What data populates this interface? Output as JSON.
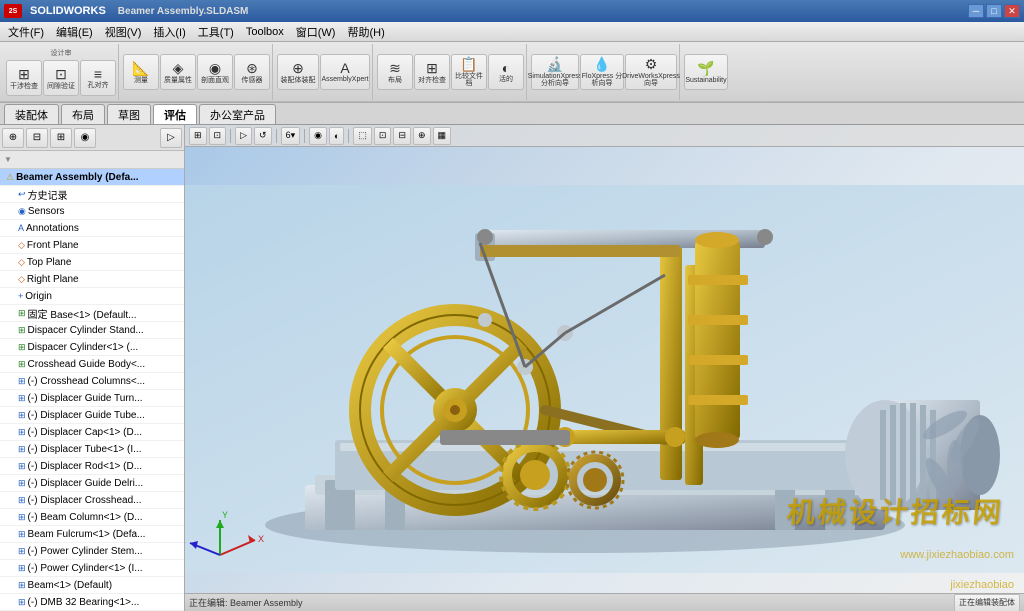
{
  "titlebar": {
    "logo": "SW",
    "title": "Beamer Assembly.SLDASM",
    "minimize": "─",
    "restore": "□",
    "close": "✕"
  },
  "menubar": {
    "items": [
      "文件(F)",
      "编辑(E)",
      "视图(V)",
      "插入(I)",
      "工具(T)",
      "Toolbox",
      "窗口(W)",
      "帮助(H)"
    ]
  },
  "toolbar": {
    "groups": [
      {
        "name": "设计审",
        "buttons": [
          {
            "icon": "⊞",
            "label": "干涉检查"
          },
          {
            "icon": "⊡",
            "label": "间隙验证"
          },
          {
            "icon": "≡",
            "label": "孔对齐"
          },
          {
            "icon": "📏",
            "label": "测量"
          },
          {
            "icon": "◈",
            "label": "质量属性"
          },
          {
            "icon": "◉",
            "label": "剖面直观"
          },
          {
            "icon": "⊛",
            "label": "传感器"
          },
          {
            "icon": "⊕",
            "label": "装配体装配"
          },
          {
            "icon": "A",
            "label": "AssemblyXpert"
          },
          {
            "icon": "≋",
            "label": "布局"
          },
          {
            "icon": "⊞",
            "label": "对齐检查"
          },
          {
            "icon": "📋",
            "label": "比较文件"
          },
          {
            "icon": "◐",
            "label": "活的"
          },
          {
            "icon": "🔬",
            "label": "SimulationXpress 分析向导"
          },
          {
            "icon": "🔭",
            "label": "FloXpress 分析向导"
          },
          {
            "icon": "⚙",
            "label": "DriveWorksXpress 向导"
          },
          {
            "icon": "🌱",
            "label": "Sustainability"
          }
        ]
      }
    ]
  },
  "tabs": [
    "装配体",
    "布局",
    "草图",
    "评估",
    "办公室产品"
  ],
  "active_tab": "评估",
  "left_panel": {
    "toolbar_buttons": [
      "⊕",
      "⊟",
      "⊞",
      "◉"
    ],
    "tree_header": "Beamer Assembly (Defa...",
    "filter_icon": "▼",
    "tree_items": [
      {
        "indent": 0,
        "icon": "⚠",
        "icon_class": "yellow",
        "text": "Beamer Assembly  (Defa..."
      },
      {
        "indent": 1,
        "icon": "↩",
        "icon_class": "blue",
        "text": "方史记录"
      },
      {
        "indent": 1,
        "icon": "◉",
        "icon_class": "blue",
        "text": "Sensors"
      },
      {
        "indent": 1,
        "icon": "A",
        "icon_class": "blue",
        "text": "Annotations"
      },
      {
        "indent": 1,
        "icon": "◇",
        "icon_class": "orange",
        "text": "Front Plane"
      },
      {
        "indent": 1,
        "icon": "◇",
        "icon_class": "orange",
        "text": "Top Plane"
      },
      {
        "indent": 1,
        "icon": "◇",
        "icon_class": "orange",
        "text": "Right Plane"
      },
      {
        "indent": 1,
        "icon": "+",
        "icon_class": "blue",
        "text": "Origin"
      },
      {
        "indent": 1,
        "icon": "⊞",
        "icon_class": "green",
        "text": "固定 Base<1>  (Default..."
      },
      {
        "indent": 1,
        "icon": "⊞",
        "icon_class": "green",
        "text": "Dispacer Cylinder Stand..."
      },
      {
        "indent": 1,
        "icon": "⊞",
        "icon_class": "green",
        "text": "Dispacer Cylinder<1>  (..."
      },
      {
        "indent": 1,
        "icon": "⊞",
        "icon_class": "green",
        "text": "Crosshead Guide Body<..."
      },
      {
        "indent": 1,
        "icon": "⊞",
        "icon_class": "blue",
        "text": "(-) Crosshead Columns<..."
      },
      {
        "indent": 1,
        "icon": "⊞",
        "icon_class": "blue",
        "text": "(-) Displacer Guide Turn..."
      },
      {
        "indent": 1,
        "icon": "⊞",
        "icon_class": "blue",
        "text": "(-) Displacer Guide Tube..."
      },
      {
        "indent": 1,
        "icon": "⊞",
        "icon_class": "blue",
        "text": "(-) Displacer Cap<1>  (D..."
      },
      {
        "indent": 1,
        "icon": "⊞",
        "icon_class": "blue",
        "text": "(-) Displacer Tube<1>  (I..."
      },
      {
        "indent": 1,
        "icon": "⊞",
        "icon_class": "blue",
        "text": "(-) Displacer Rod<1>  (D..."
      },
      {
        "indent": 1,
        "icon": "⊞",
        "icon_class": "blue",
        "text": "(-) Displacer Guide Delri..."
      },
      {
        "indent": 1,
        "icon": "⊞",
        "icon_class": "blue",
        "text": "(-) Displacer Crosshead..."
      },
      {
        "indent": 1,
        "icon": "⊞",
        "icon_class": "blue",
        "text": "(-) Beam Column<1>  (D..."
      },
      {
        "indent": 1,
        "icon": "⊞",
        "icon_class": "blue",
        "text": "Beam Fulcrum<1>  (Defa..."
      },
      {
        "indent": 1,
        "icon": "⊞",
        "icon_class": "blue",
        "text": "(-) Power Cylinder Stem..."
      },
      {
        "indent": 1,
        "icon": "⊞",
        "icon_class": "blue",
        "text": "(-) Power Cylinder<1>  (I..."
      },
      {
        "indent": 1,
        "icon": "⊞",
        "icon_class": "blue",
        "text": "Beam<1>  (Default)"
      },
      {
        "indent": 1,
        "icon": "⊞",
        "icon_class": "blue",
        "text": "(-) DMB 32 Bearing<1>..."
      }
    ]
  },
  "viewport": {
    "toolbar_items": [
      "◈",
      "⊞",
      "▷",
      "↺",
      "⊙",
      "‥",
      "6▾",
      "◉",
      "◐",
      "⬚",
      "⊡",
      "⊟",
      "⊕",
      "▦"
    ],
    "watermark_line1": "机械设计招标网",
    "watermark_line2": "www.jixiezhaobiao.com",
    "watermark_line3": "jixiezhaobiao"
  },
  "statusbar": {
    "text": "正在编辑: Beamer Assembly"
  },
  "colors": {
    "accent_blue": "#2a5a9f",
    "gold": "#c8a020",
    "silver": "#b0b8c0",
    "bg_light": "#f0f0f0",
    "bg_dark": "#d0d0d0"
  }
}
